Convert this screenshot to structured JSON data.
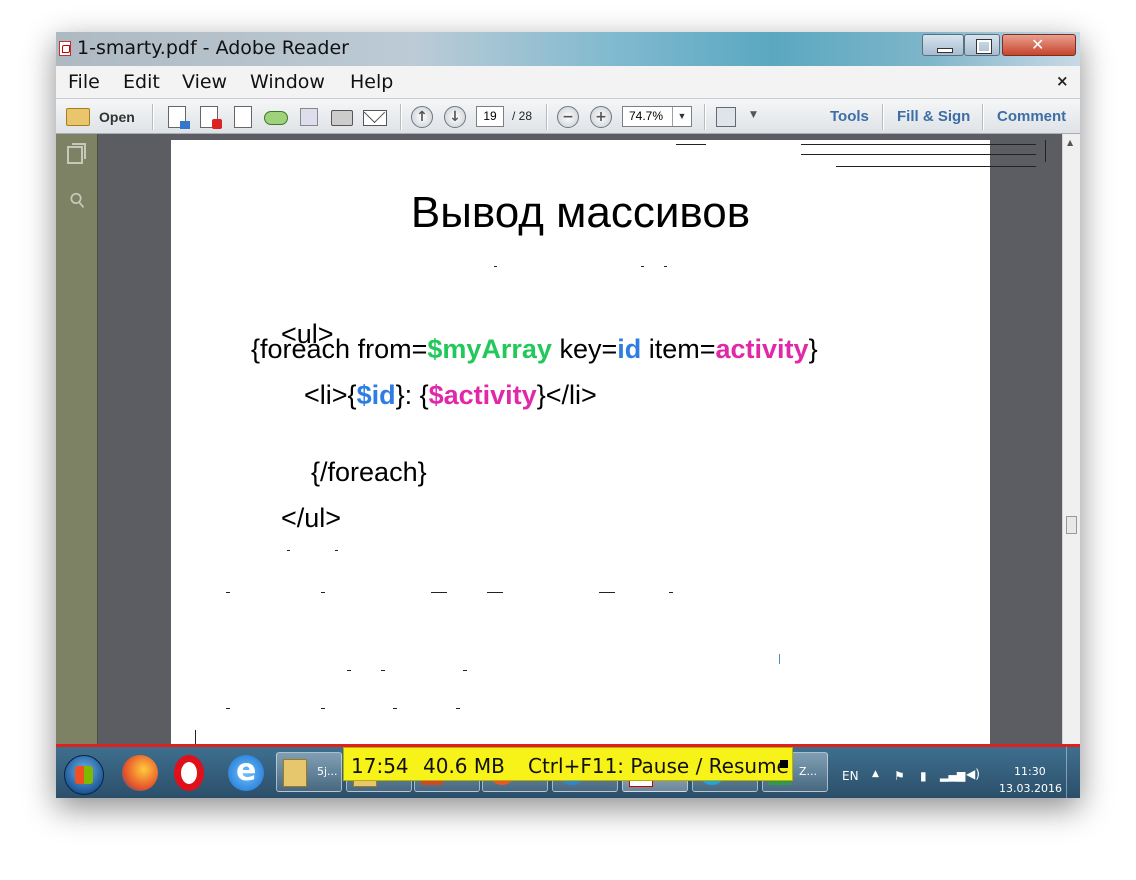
{
  "window": {
    "title": "1-smarty.pdf - Adobe Reader"
  },
  "menu": {
    "items": [
      "File",
      "Edit",
      "View",
      "Window",
      "Help"
    ],
    "close": "×"
  },
  "toolbar": {
    "open_label": "Open",
    "page_current": "19",
    "page_total": "/ 28",
    "zoom": "74.7%",
    "tools_label": "Tools",
    "fill_sign_label": "Fill & Sign",
    "comment_label": "Comment"
  },
  "document": {
    "title": "Вывод массивов",
    "code": {
      "l1": "<ul>",
      "l2_a": "{foreach from=",
      "l2_var": "$myArray",
      "l2_b": " key=",
      "l2_key": "id",
      "l2_c": " item=",
      "l2_item": "activity",
      "l2_d": "}",
      "l3_a": "<li>{",
      "l3_id": "$id",
      "l3_b": "}: {",
      "l3_act": "$activity",
      "l3_c": "}</li>",
      "l4": "{/foreach}",
      "l5": "</ul>"
    }
  },
  "recorder": {
    "time": "17:54",
    "size": "40.6 MB",
    "hint": "Ctrl+F11: Pause / Resume"
  },
  "taskbar": {
    "buttons": [
      "5j...",
      "Z..."
    ],
    "lang": "EN",
    "time": "11:30",
    "date": "13.03.2016"
  },
  "colors": {
    "green": "#21c85a",
    "blue": "#2f7de1",
    "magenta": "#e028a8",
    "recorder_bg": "#f7f318"
  }
}
